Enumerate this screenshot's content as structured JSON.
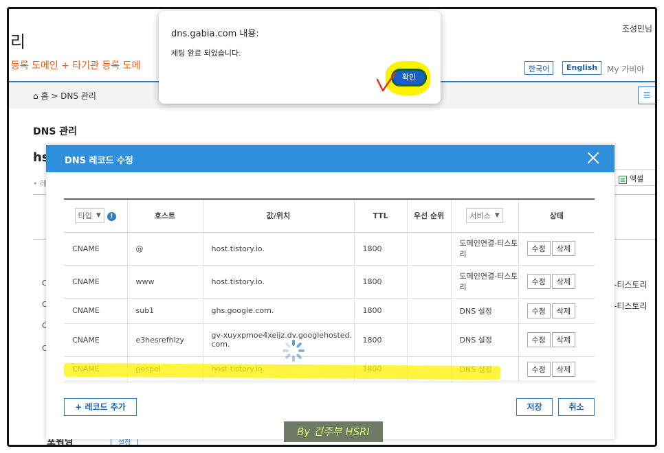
{
  "background": {
    "page_title_fragment": "리",
    "user_fragment": "조성민님",
    "banner_fragment": "· 등록 도메인 + 타기관 등록 도메",
    "lang_korean": "한국어",
    "lang_english": "English",
    "my_gabia": "My 가비아",
    "breadcrumb": "홈 > DNS 관리",
    "section_title": "DNS 관리",
    "domain_fragment": "hs",
    "tab_fragment": "• 레",
    "excel_label": "엑셀",
    "row_right_1": "-티스토리",
    "row_right_2": "-티스토리",
    "row_left": [
      "C",
      "C",
      "C",
      "C"
    ],
    "bottom_fragment": "포워딩",
    "bottom_btn": "설정"
  },
  "modal": {
    "title": "DNS 레코드 수정",
    "columns": {
      "type": "타입",
      "host": "호스트",
      "value": "값/위치",
      "ttl": "TTL",
      "priority": "우선 순위",
      "service": "서비스",
      "status": "상태"
    },
    "rows": [
      {
        "type": "CNAME",
        "host": "@",
        "value": "host.tistory.io.",
        "ttl": "1800",
        "priority": "",
        "service": "도메인연결-티스토리",
        "edit": "수정",
        "delete": "삭제"
      },
      {
        "type": "CNAME",
        "host": "www",
        "value": "host.tistory.io.",
        "ttl": "1800",
        "priority": "",
        "service": "도메인연결-티스토리",
        "edit": "수정",
        "delete": "삭제"
      },
      {
        "type": "CNAME",
        "host": "sub1",
        "value": "ghs.google.com.",
        "ttl": "1800",
        "priority": "",
        "service": "DNS 설정",
        "edit": "수정",
        "delete": "삭제"
      },
      {
        "type": "CNAME",
        "host": "e3hesrefhlzy",
        "value": "gv-xuyxpmoe4xeijz.dv.googlehosted.com.",
        "ttl": "1800",
        "priority": "",
        "service": "DNS 설정",
        "edit": "수정",
        "delete": "삭제"
      },
      {
        "type": "CNAME",
        "host": "gospel",
        "value": "host.tistory.io.",
        "ttl": "1800",
        "priority": "",
        "service": "DNS 설정",
        "edit": "수정",
        "delete": "삭제"
      }
    ],
    "add_record": "+ 레코드 추가",
    "save": "저장",
    "cancel": "취소"
  },
  "alert": {
    "title": "dns.gabia.com 내용:",
    "message": "세팅 완료 되었습니다.",
    "ok": "확인"
  },
  "watermark": "By 건주부 HSRI",
  "colors": {
    "accent": "#2f8fdb",
    "highlight": "#fff200",
    "banner": "#e8590c"
  }
}
